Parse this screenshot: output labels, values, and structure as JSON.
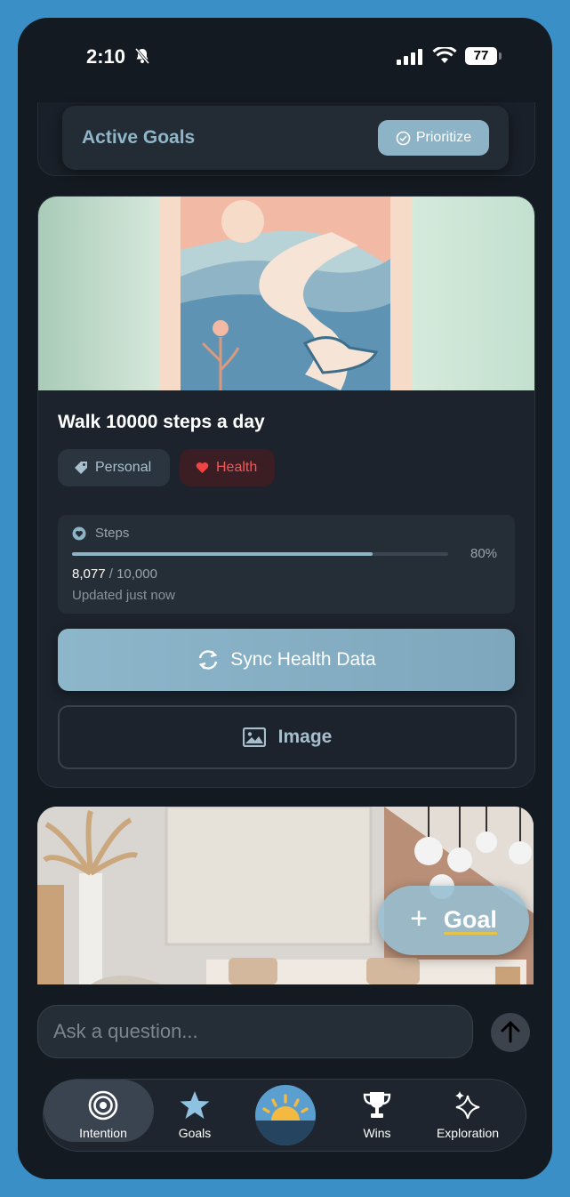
{
  "status": {
    "time": "2:10",
    "battery": "77"
  },
  "header": {
    "title": "Active Goals",
    "prioritize_label": "Prioritize"
  },
  "goal": {
    "title": "Walk 10000 steps a day",
    "tags": [
      "Personal",
      "Health"
    ],
    "metric": {
      "label": "Steps",
      "percent_label": "80%",
      "progress": 0.8,
      "current": "8,077",
      "target": "10,000",
      "updated": "Updated just now"
    },
    "sync_label": "Sync Health Data",
    "image_label": "Image"
  },
  "fab": {
    "plus": "+",
    "label": "Goal"
  },
  "chat": {
    "placeholder": "Ask a question..."
  },
  "nav": {
    "items": [
      {
        "label": "Intention",
        "icon": "target-icon"
      },
      {
        "label": "Goals",
        "icon": "star-icon"
      },
      {
        "label": "",
        "icon": "sunrise-icon"
      },
      {
        "label": "Wins",
        "icon": "trophy-icon"
      },
      {
        "label": "Exploration",
        "icon": "sparkles-icon"
      }
    ]
  },
  "colors": {
    "accent": "#8db3c7",
    "health": "#ef5a5a",
    "background": "#141a21",
    "frame": "#3a8fc7"
  }
}
